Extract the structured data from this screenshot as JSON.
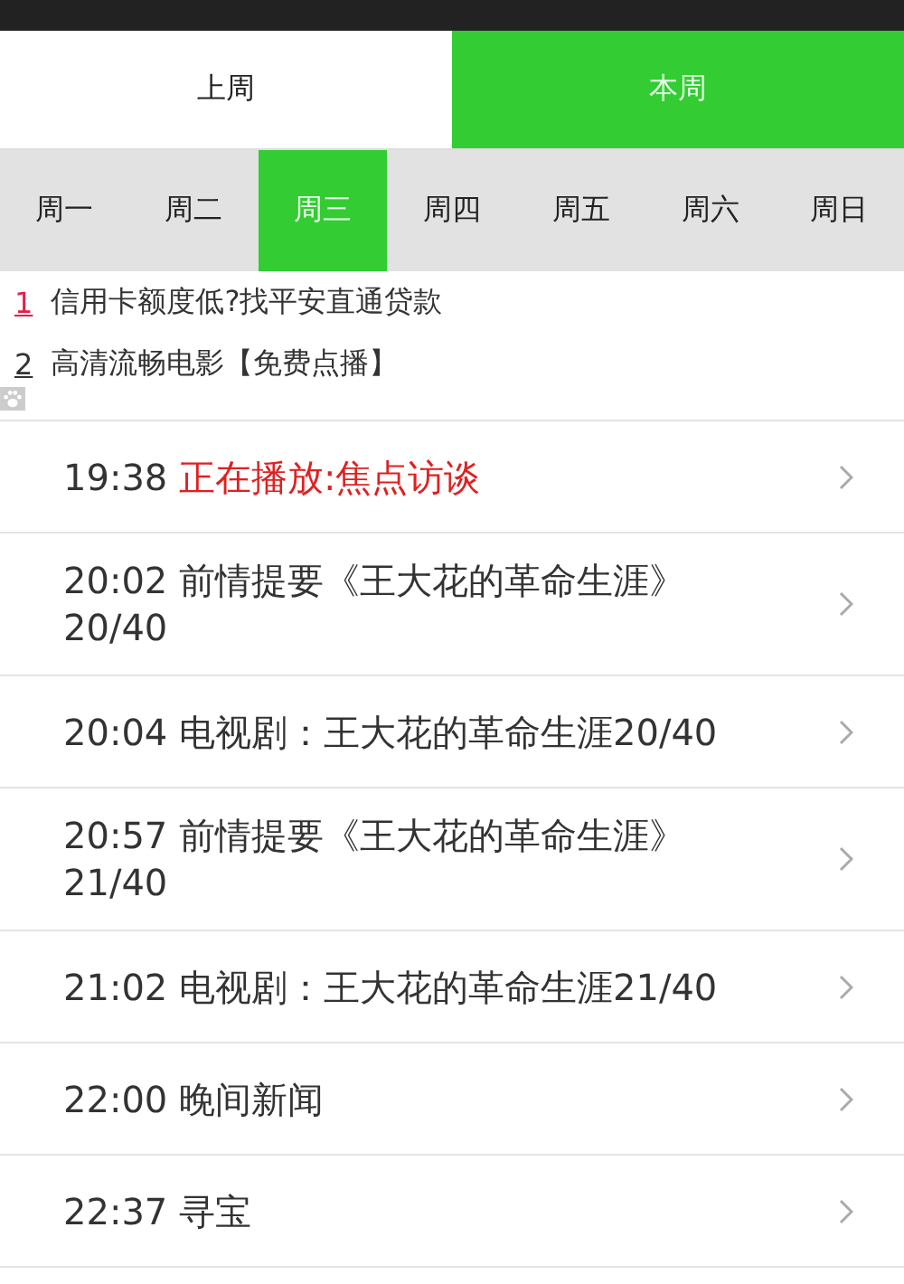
{
  "week_tabs": [
    {
      "label": "上周",
      "selected": false
    },
    {
      "label": "本周",
      "selected": true
    }
  ],
  "day_tabs": [
    {
      "label": "周一",
      "selected": false
    },
    {
      "label": "周二",
      "selected": false
    },
    {
      "label": "周三",
      "selected": true
    },
    {
      "label": "周四",
      "selected": false
    },
    {
      "label": "周五",
      "selected": false
    },
    {
      "label": "周六",
      "selected": false
    },
    {
      "label": "周日",
      "selected": false
    }
  ],
  "ads": [
    {
      "number": "1",
      "text": "信用卡额度低?找平安直通贷款",
      "highlighted": true
    },
    {
      "number": "2",
      "text": "高清流畅电影【免费点播】",
      "highlighted": false
    }
  ],
  "programs": [
    {
      "time": "19:38",
      "title": "正在播放:焦点访谈",
      "playing": true
    },
    {
      "time": "20:02",
      "title": "前情提要《王大花的革命生涯》20/40",
      "playing": false
    },
    {
      "time": "20:04",
      "title": "电视剧：王大花的革命生涯20/40",
      "playing": false
    },
    {
      "time": "20:57",
      "title": "前情提要《王大花的革命生涯》21/40",
      "playing": false
    },
    {
      "time": "21:02",
      "title": "电视剧：王大花的革命生涯21/40",
      "playing": false
    },
    {
      "time": "22:00",
      "title": "晚间新闻",
      "playing": false
    },
    {
      "time": "22:37",
      "title": "寻宝",
      "playing": false
    }
  ]
}
